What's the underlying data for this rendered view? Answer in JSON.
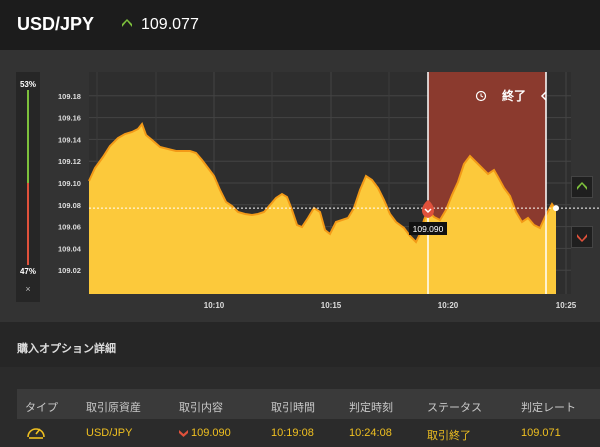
{
  "header": {
    "pair": "USD/JPY",
    "rate": "109.077"
  },
  "meter": {
    "top_pct": "53%",
    "bottom_pct": "47%",
    "close": "×"
  },
  "expiry": {
    "label": "終了"
  },
  "marker": {
    "price": "109.090"
  },
  "colors": {
    "area": "#fcc93b",
    "area_edge": "#f39a17",
    "expired_band": "#8b3a2e",
    "up": "#7dc03c",
    "down": "#e0513b"
  },
  "chart_data": {
    "type": "area",
    "y_ticks": [
      "109.02",
      "109.04",
      "109.06",
      "109.08",
      "109.10",
      "109.12",
      "109.14",
      "109.16",
      "109.18"
    ],
    "x_ticks": [
      "10:10",
      "10:15",
      "10:20",
      "10:25"
    ],
    "ylim": [
      109.0,
      109.2
    ],
    "current_rate": 109.077,
    "entry_rate": 109.09
  },
  "section": {
    "title": "購入オプション詳細"
  },
  "table": {
    "headers": [
      "タイプ",
      "取引原資産",
      "取引内容",
      "取引時間",
      "判定時刻",
      "ステータス",
      "判定レート"
    ],
    "row": {
      "type_icon": "gauge-icon",
      "asset": "USD/JPY",
      "content": "109.090",
      "trade_time": "10:19:08",
      "judge_time": "10:24:08",
      "status": "取引終了",
      "judge_rate": "109.071"
    }
  }
}
